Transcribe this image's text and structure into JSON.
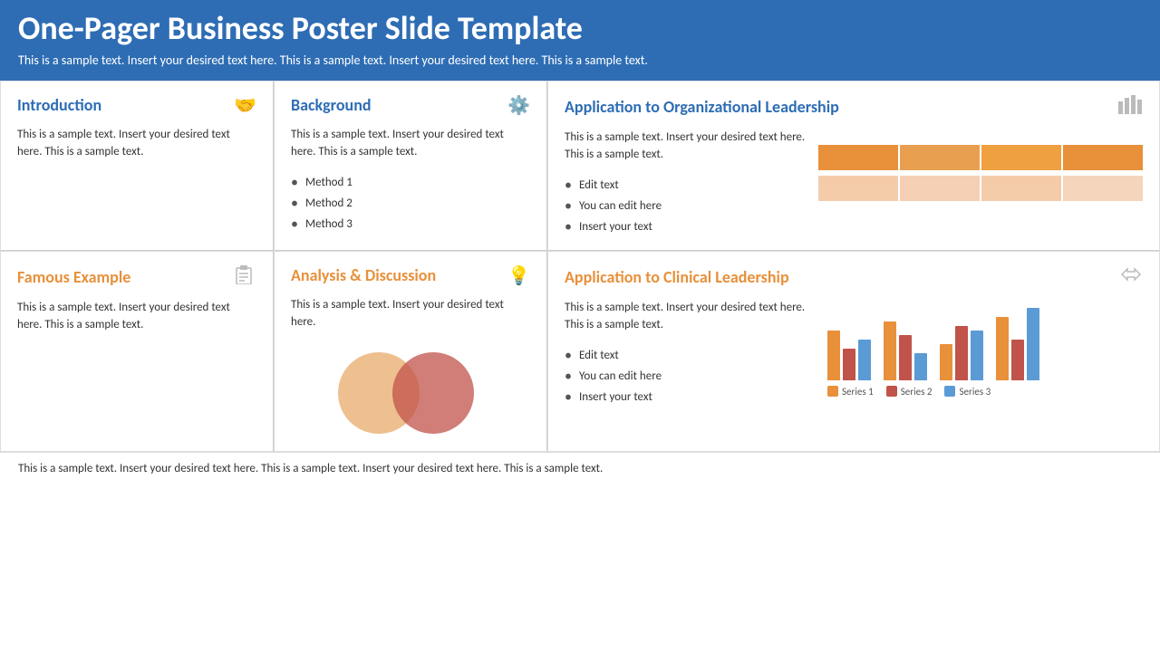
{
  "header": {
    "title": "One-Pager Business Poster Slide Template",
    "subtitle": "This is a sample text. Insert your desired text here. This is a sample text. Insert your desired text here. This is a sample text."
  },
  "sections": {
    "introduction": {
      "title": "Introduction",
      "icon": "🤝",
      "text": "This is a sample text. Insert your desired text here. This is a sample text."
    },
    "background": {
      "title": "Background",
      "icon": "⚙️",
      "text": "This is a sample text. Insert your desired text here. This is a sample text.",
      "bullets": [
        "Method 1",
        "Method 2",
        "Method 3"
      ]
    },
    "org_leadership": {
      "title": "Application to Organizational Leadership",
      "icon": "📊",
      "text": "This is a sample text. Insert your desired text here. This is a sample text.",
      "bullets": [
        "Edit text",
        "You can edit here",
        "Insert your text"
      ]
    },
    "famous_example": {
      "title": "Famous Example",
      "icon": "📋",
      "text": "This is a sample text. Insert your desired text here. This is a sample text."
    },
    "analysis": {
      "title": "Analysis & Discussion",
      "icon": "💡",
      "text": "This is a sample text. Insert your desired text here."
    },
    "clinical_leadership": {
      "title": "Application to Clinical Leadership",
      "icon": "🔀",
      "text": "This is a sample text. Insert your desired text here. This is a sample text.",
      "bullets": [
        "Edit text",
        "You can edit here",
        "Insert your text"
      ]
    }
  },
  "charts": {
    "org_bars": {
      "row1_color": "#E8903A",
      "row2_color": "#F5CCAA",
      "segments": [
        4
      ]
    },
    "venn": {
      "left_color": "#E8A96A",
      "right_color": "#C0534A"
    },
    "clinical_bars": {
      "series1_color": "#E8903A",
      "series2_color": "#C0534A",
      "series3_color": "#5B9BD5",
      "series1_label": "Series 1",
      "series2_label": "Series 2",
      "series3_label": "Series 3",
      "groups": [
        {
          "s1": 55,
          "s2": 35,
          "s3": 45
        },
        {
          "s1": 65,
          "s2": 50,
          "s3": 30
        },
        {
          "s1": 40,
          "s2": 60,
          "s3": 55
        },
        {
          "s1": 70,
          "s2": 45,
          "s3": 80
        }
      ]
    }
  },
  "footer": {
    "text": "This is a sample text. Insert your desired text here. This is a sample text. Insert your desired text here. This is a sample text."
  }
}
